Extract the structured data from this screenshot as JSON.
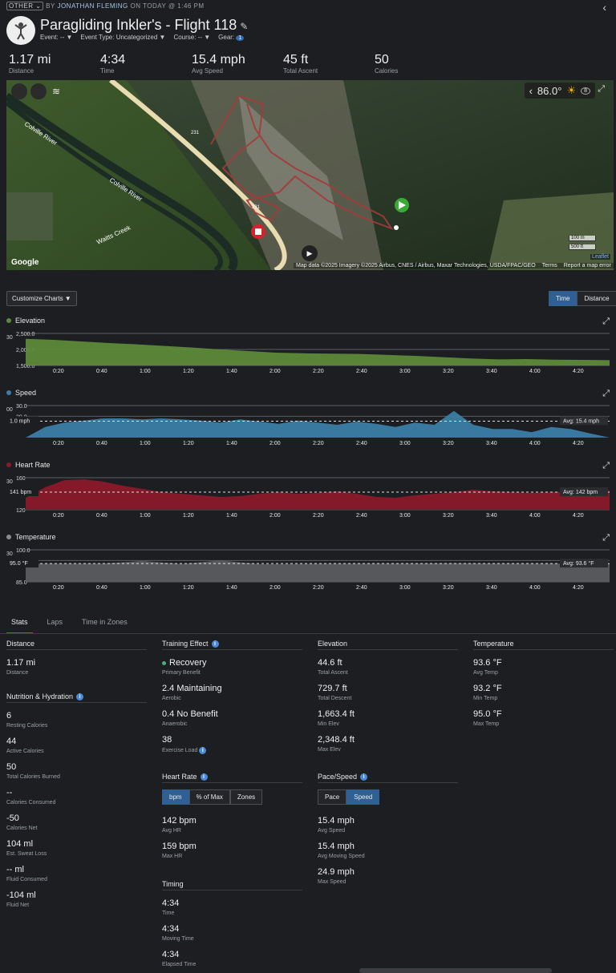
{
  "header": {
    "category": "OTHER",
    "by": "BY",
    "user": "JONATHAN FLEMING",
    "when": "ON TODAY @ 1:46 PM",
    "title": "Paragliding Inkler's - Flight 118",
    "meta": {
      "event": "Event: --",
      "event_type": "Event Type: Uncategorized",
      "course": "Course: --",
      "gear": "Gear:",
      "gear_count": "1"
    }
  },
  "summary": [
    {
      "value": "1.17 mi",
      "label": "Distance"
    },
    {
      "value": "4:34",
      "label": "Time"
    },
    {
      "value": "15.4 mph",
      "label": "Avg Speed"
    },
    {
      "value": "45 ft",
      "label": "Total Ascent"
    },
    {
      "value": "50",
      "label": "Calories"
    }
  ],
  "map": {
    "temp": "86.0°",
    "weather_count": "8",
    "labels": {
      "river1": "Colville River",
      "river2": "Colville River",
      "creek": "Waitts Creek",
      "road1": "231",
      "road2": "231"
    },
    "google": "Google",
    "attribution": "Map data ©2025 Imagery ©2025 Airbus, CNES / Airbus, Maxar Technologies, USDA/FPAC/GEO",
    "terms": "Terms",
    "report": "Report a map error",
    "scale_m": "100 m",
    "scale_ft": "500 ft",
    "leaflet": "Leaflet"
  },
  "controls": {
    "customize": "Customize Charts",
    "time": "Time",
    "distance": "Distance"
  },
  "chart_data": [
    {
      "type": "area",
      "title": "Elevation",
      "color": "#5d8a3a",
      "x": [
        "0:20",
        "0:40",
        "1:00",
        "1:20",
        "1:40",
        "2:00",
        "2:20",
        "2:40",
        "3:00",
        "3:20",
        "3:40",
        "4:00",
        "4:20"
      ],
      "yticks": [
        "2,500.0",
        "2,000.0",
        "1,500.0"
      ],
      "ylim": [
        1500,
        2500
      ],
      "series": [
        2330,
        2300,
        2250,
        2200,
        2160,
        2110,
        2060,
        2000,
        1950,
        1900,
        1880,
        1870,
        1860,
        1830,
        1800,
        1760,
        1720,
        1690,
        1700,
        1680,
        1675,
        1665
      ],
      "left_marker": "30"
    },
    {
      "type": "area",
      "title": "Speed",
      "color": "#3b7ea6",
      "x": [
        "0:20",
        "0:40",
        "1:00",
        "1:20",
        "1:40",
        "2:00",
        "2:20",
        "2:40",
        "3:00",
        "3:20",
        "3:40",
        "4:00",
        "4:20"
      ],
      "yticks": [
        "30.0",
        "20.0"
      ],
      "ylim": [
        0,
        30
      ],
      "series": [
        0,
        10,
        14,
        16,
        18,
        18,
        17,
        18,
        17,
        16,
        14,
        17,
        15,
        13,
        16,
        14,
        12,
        15,
        13,
        10,
        14,
        12,
        25,
        12,
        8,
        8,
        5,
        10,
        8,
        4,
        0
      ],
      "avg_label": "Avg: 15.4 mph",
      "avg_value": 15.4,
      "cursor_label": "1.0 mph",
      "left_marker": "00"
    },
    {
      "type": "area",
      "title": "Heart Rate",
      "color": "#8a1a2a",
      "x": [
        "0:20",
        "0:40",
        "1:00",
        "1:20",
        "1:40",
        "2:00",
        "2:20",
        "2:40",
        "3:00",
        "3:20",
        "3:40",
        "4:00",
        "4:20"
      ],
      "yticks": [
        "160",
        "120"
      ],
      "ylim": [
        120,
        160
      ],
      "series": [
        135,
        148,
        157,
        158,
        155,
        150,
        146,
        142,
        140,
        138,
        136,
        137,
        140,
        142,
        140,
        141,
        143,
        140,
        136,
        135,
        138,
        140,
        142,
        145,
        143,
        142,
        141,
        142,
        143,
        142,
        144
      ],
      "avg_label": "Avg: 142 bpm",
      "avg_value": 142,
      "cursor_label": "141 bpm",
      "left_marker": "30"
    },
    {
      "type": "area",
      "title": "Temperature",
      "color": "#5a5c5f",
      "x": [
        "0:20",
        "0:40",
        "1:00",
        "1:20",
        "1:40",
        "2:00",
        "2:20",
        "2:40",
        "3:00",
        "3:20",
        "3:40",
        "4:00",
        "4:20"
      ],
      "yticks": [
        "100.0",
        "95.0",
        "85.0"
      ],
      "ylim": [
        85,
        100
      ],
      "series": [
        93.5,
        93.5,
        93.6,
        94.8,
        93.4,
        95.0,
        93.3,
        93.4,
        93.5,
        93.5,
        93.6,
        93.7,
        93.6,
        93.5,
        93.5,
        93.6
      ],
      "avg_label": "Avg: 93.6 °F",
      "avg_value": 93.6,
      "cursor_label": "95.0 °F",
      "left_marker": "30"
    }
  ],
  "tabs": [
    "Stats",
    "Laps",
    "Time in Zones"
  ],
  "stats": {
    "distance": {
      "title": "Distance",
      "items": [
        {
          "value": "1.17 mi",
          "label": "Distance"
        }
      ]
    },
    "nutrition": {
      "title": "Nutrition & Hydration",
      "items": [
        {
          "value": "6",
          "label": "Resting Calories"
        },
        {
          "value": "44",
          "label": "Active Calories"
        },
        {
          "value": "50",
          "label": "Total Calories Burned"
        },
        {
          "value": "--",
          "label": "Calories Consumed"
        },
        {
          "value": "-50",
          "label": "Calories Net"
        },
        {
          "value": "104 ml",
          "label": "Est. Sweat Loss"
        },
        {
          "value": "-- ml",
          "label": "Fluid Consumed"
        },
        {
          "value": "-104 ml",
          "label": "Fluid Net"
        }
      ]
    },
    "training": {
      "title": "Training Effect",
      "items": [
        {
          "value": "Recovery",
          "label": "Primary Benefit"
        },
        {
          "value": "2.4 Maintaining",
          "label": "Aerobic"
        },
        {
          "value": "0.4 No Benefit",
          "label": "Anaerobic"
        },
        {
          "value": "38",
          "label": "Exercise Load"
        }
      ]
    },
    "heart": {
      "title": "Heart Rate",
      "toggle": [
        "bpm",
        "% of Max",
        "Zones"
      ],
      "items": [
        {
          "value": "142 bpm",
          "label": "Avg HR"
        },
        {
          "value": "159 bpm",
          "label": "Max HR"
        }
      ]
    },
    "timing": {
      "title": "Timing",
      "items": [
        {
          "value": "4:34",
          "label": "Time"
        },
        {
          "value": "4:34",
          "label": "Moving Time"
        },
        {
          "value": "4:34",
          "label": "Elapsed Time"
        }
      ]
    },
    "elevation": {
      "title": "Elevation",
      "items": [
        {
          "value": "44.6 ft",
          "label": "Total Ascent"
        },
        {
          "value": "729.7 ft",
          "label": "Total Descent"
        },
        {
          "value": "1,663.4 ft",
          "label": "Min Elev"
        },
        {
          "value": "2,348.4 ft",
          "label": "Max Elev"
        }
      ]
    },
    "pace": {
      "title": "Pace/Speed",
      "toggle": [
        "Pace",
        "Speed"
      ],
      "items": [
        {
          "value": "15.4 mph",
          "label": "Avg Speed"
        },
        {
          "value": "15.4 mph",
          "label": "Avg Moving Speed"
        },
        {
          "value": "24.9 mph",
          "label": "Max Speed"
        }
      ]
    },
    "temperature": {
      "title": "Temperature",
      "items": [
        {
          "value": "93.6 °F",
          "label": "Avg Temp"
        },
        {
          "value": "93.2 °F",
          "label": "Min Temp"
        },
        {
          "value": "95.0 °F",
          "label": "Max Temp"
        }
      ]
    }
  }
}
